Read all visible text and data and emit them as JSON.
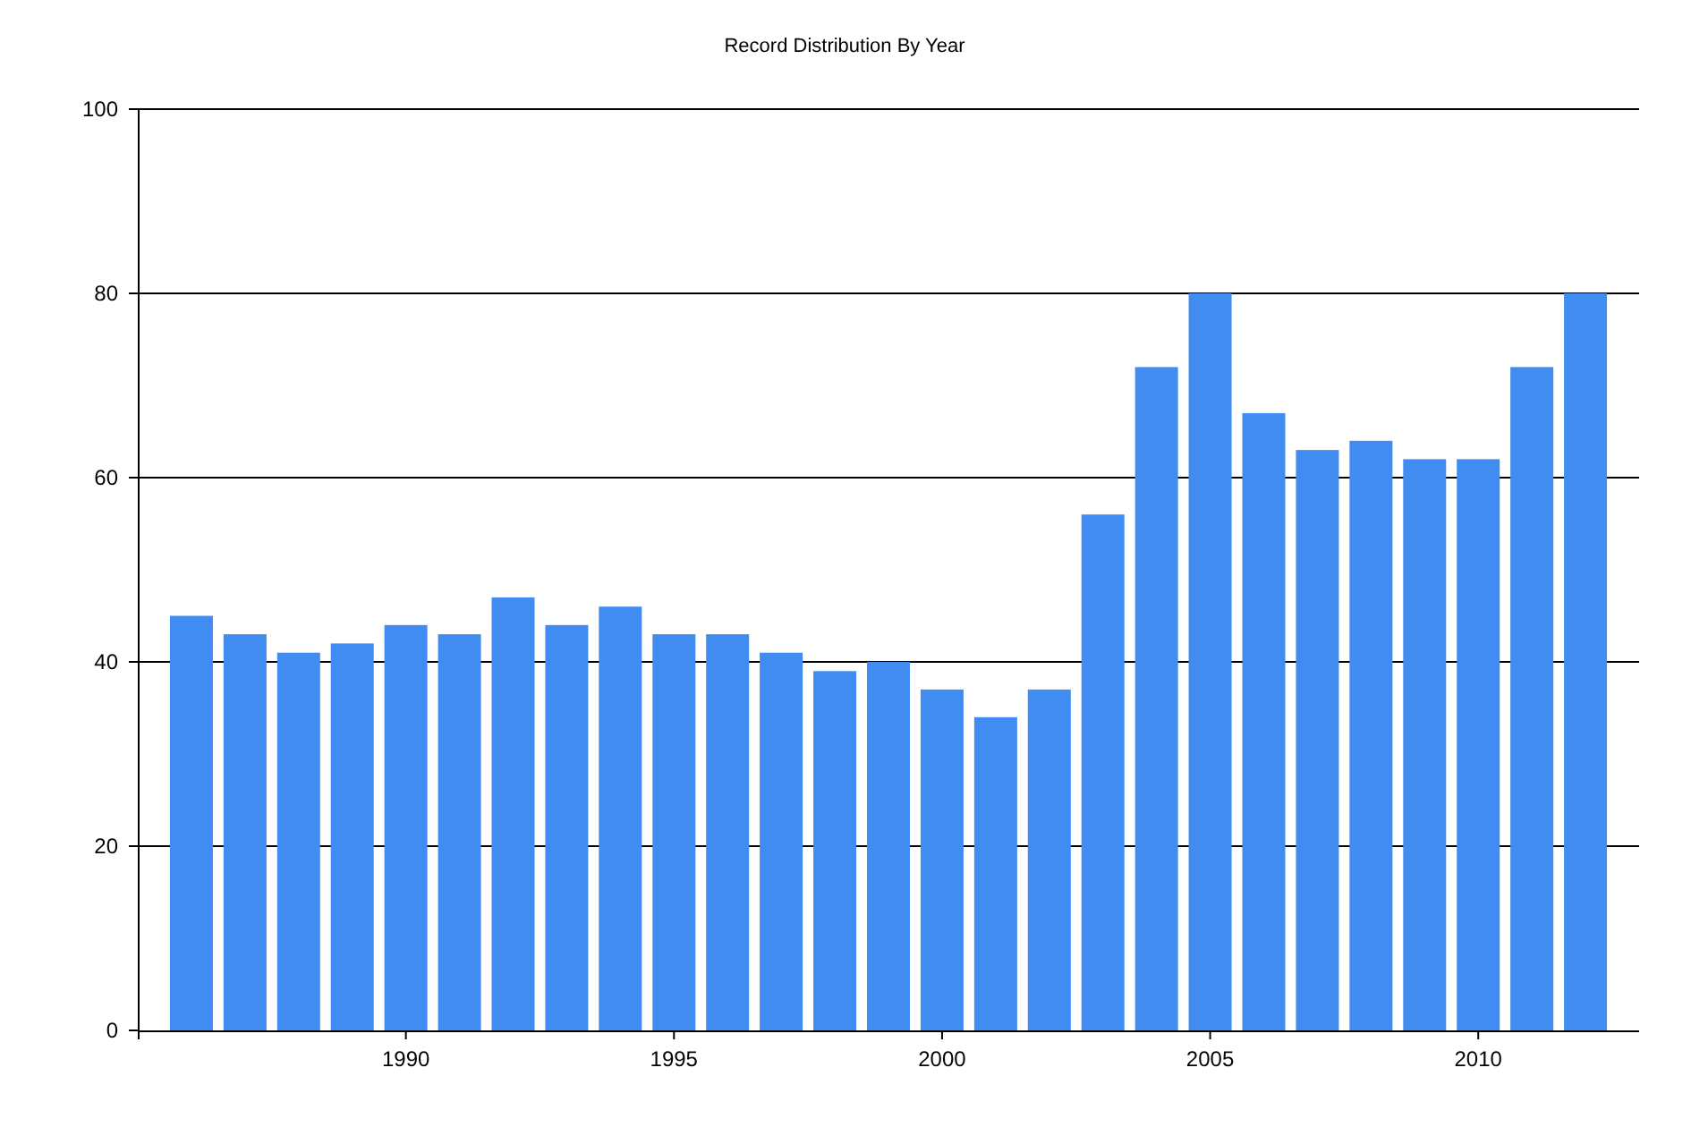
{
  "chart": {
    "chart_data": {
      "type": "bar",
      "title": "Record Distribution By Year",
      "x": [
        1986,
        1987,
        1988,
        1989,
        1990,
        1991,
        1992,
        1993,
        1994,
        1995,
        1996,
        1997,
        1998,
        1999,
        2000,
        2001,
        2002,
        2003,
        2004,
        2005,
        2006,
        2007,
        2008,
        2009,
        2010,
        2011,
        2012
      ],
      "values": [
        45,
        43,
        41,
        42,
        44,
        43,
        47,
        44,
        46,
        43,
        43,
        41,
        39,
        40,
        37,
        34,
        37,
        56,
        72,
        80,
        67,
        63,
        64,
        62,
        62,
        72,
        80
      ],
      "xlim": [
        1985,
        2013
      ],
      "ylim": [
        0,
        100
      ],
      "xticks": [
        1990,
        1995,
        2000,
        2005,
        2010
      ],
      "yticks": [
        0,
        20,
        40,
        60,
        80,
        100
      ],
      "grid": true
    }
  }
}
